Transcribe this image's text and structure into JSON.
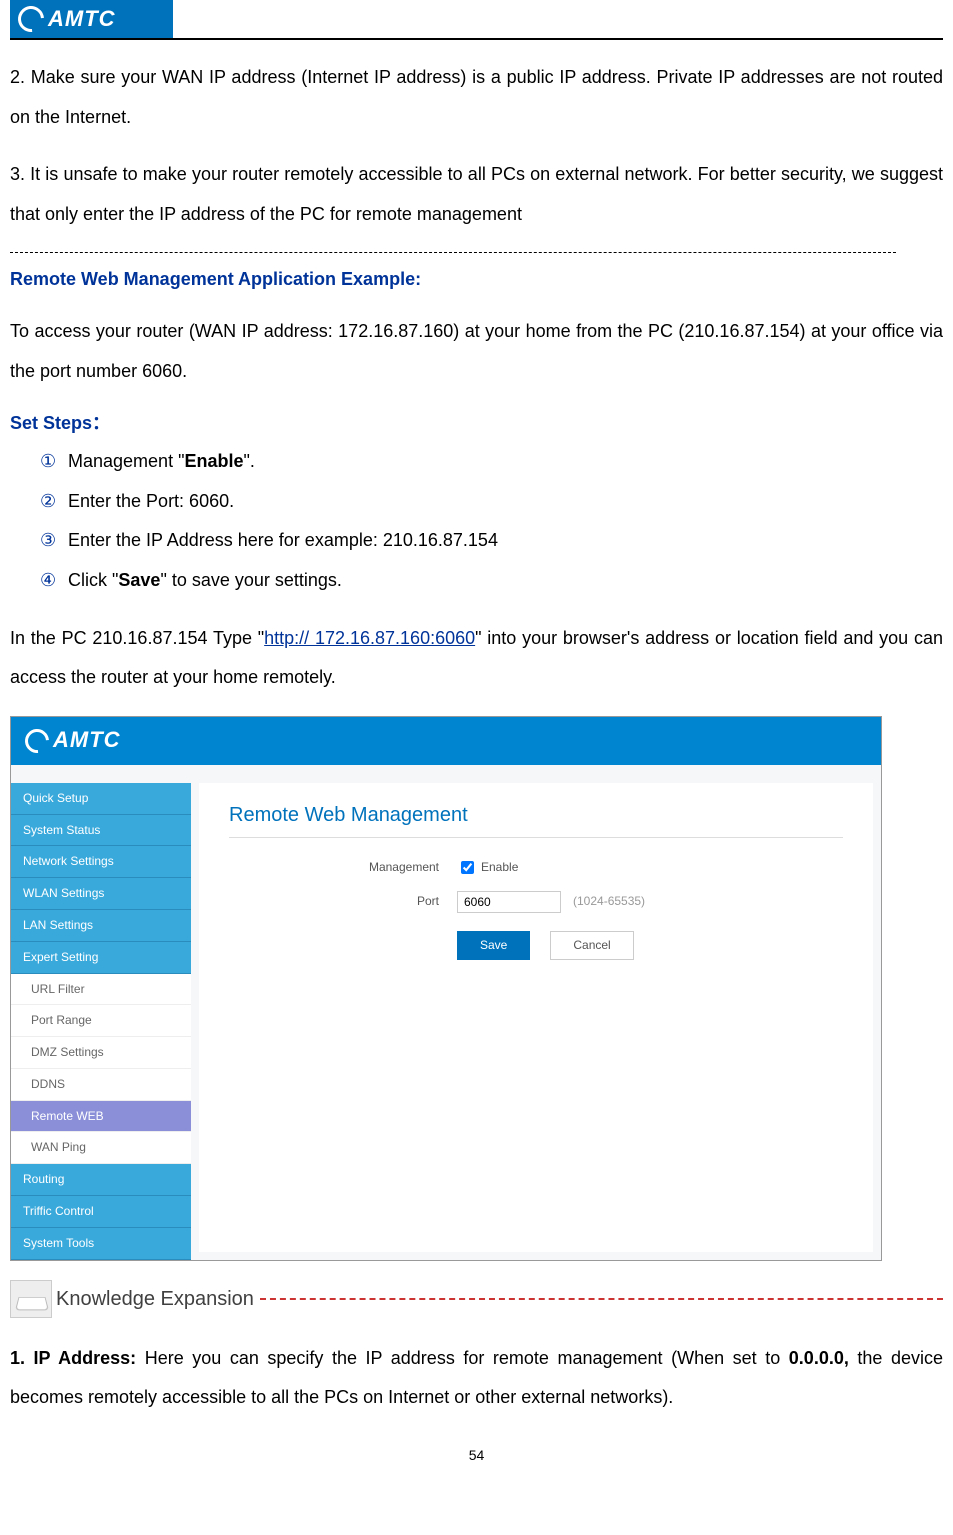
{
  "header": {
    "logo_text": "AMTC"
  },
  "body": {
    "p1": "2. Make sure your WAN IP address (Internet IP address) is a public IP address. Private IP addresses are not routed on the Internet.",
    "p2": "3. It is unsafe to make your router remotely accessible to all PCs on external network. For better security, we suggest that only enter the IP address of the PC for remote management",
    "heading1": "Remote Web Management Application Example:",
    "p3": "To access your router (WAN IP address: 172.16.87.160) at your home from the PC (210.16.87.154) at your office via the port number 6060.",
    "heading2": "Set Steps：",
    "steps": {
      "n1": "①",
      "s1a": "Management \"",
      "s1b": "Enable",
      "s1c": "\".",
      "n2": "②",
      "s2": "Enter the Port: 6060.",
      "n3": "③",
      "s3": "Enter the IP Address here for example: 210.16.87.154",
      "n4": "④",
      "s4a": "Click \"",
      "s4b": "Save",
      "s4c": "\" to save your settings."
    },
    "p4a": "In the PC 210.16.87.154 Type \"",
    "p4link": "http:// 172.16.87.160:6060",
    "p4b": "\" into your browser's address or location field and you can access the router at your home remotely.",
    "ke_title": "Knowledge Expansion",
    "p5a": "1. IP Address: ",
    "p5b": "Here you can specify the IP address for remote management (When set to ",
    "p5c": "0.0.0.0,",
    "p5d": " the device becomes remotely accessible to all the PCs on Internet or other external networks).",
    "page_num": "54"
  },
  "router": {
    "logo": "AMTC",
    "help": "?",
    "menu": [
      "Quick Setup",
      "System Status",
      "Network Settings",
      "WLAN Settings",
      "LAN Settings",
      "Expert Setting"
    ],
    "submenu": [
      "URL Filter",
      "Port Range",
      "DMZ Settings",
      "DDNS",
      "Remote WEB",
      "WAN Ping"
    ],
    "menu2": [
      "Routing",
      "Triffic Control",
      "System Tools"
    ],
    "content_title": "Remote Web Management",
    "label_mgmt": "Management",
    "label_enable": "Enable",
    "label_port": "Port",
    "port_value": "6060",
    "port_range": "(1024-65535)",
    "btn_save": "Save",
    "btn_cancel": "Cancel"
  }
}
